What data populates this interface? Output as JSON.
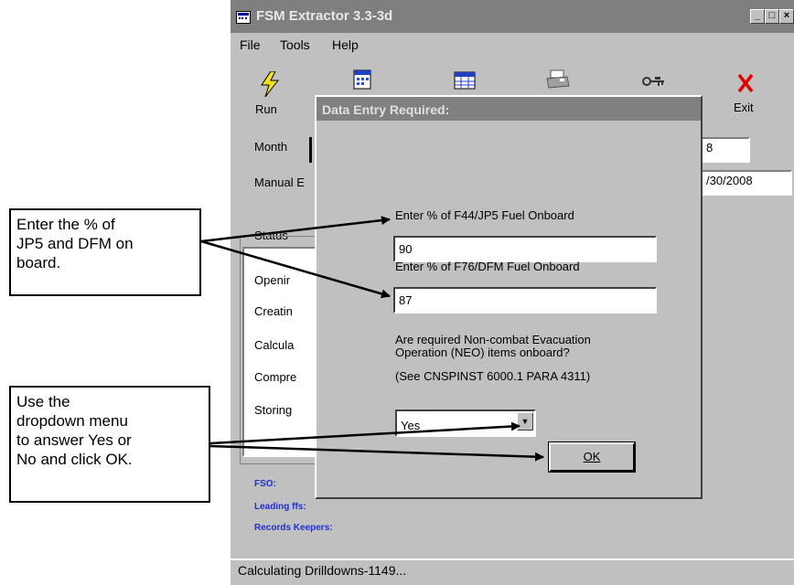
{
  "window": {
    "title": "FSM Extractor 3.3-3d"
  },
  "menu": {
    "file": "File",
    "tools": "Tools",
    "help": "Help"
  },
  "toolbar": {
    "run": "Run",
    "exit": "Exit"
  },
  "form": {
    "month_label": "Month",
    "manual_label": "Manual E",
    "month_value_tail": "8",
    "date_value_tail": "/30/2008",
    "status_label": "Status",
    "status_items": [
      "Openir",
      "Creatin",
      "Calcula",
      "Compre",
      "Storing"
    ],
    "fso_label": "FSO:",
    "leading_label": "Leading ffs:",
    "records_label": "Records Keepers:"
  },
  "statusbar": {
    "text": "Calculating Drilldowns-1149..."
  },
  "dialog": {
    "title": "Data Entry Required:",
    "jp5_label": "Enter % of F44/JP5 Fuel Onboard",
    "jp5_value": "90",
    "dfm_label": "Enter % of F76/DFM Fuel Onboard",
    "dfm_value": "87",
    "neo_question_1": "Are required Non-combat Evacuation",
    "neo_question_2": "Operation (NEO) items onboard?",
    "neo_reference": "(See CNSPINST 6000.1 PARA 4311)",
    "neo_selected": "Yes",
    "ok_label": "OK"
  },
  "callouts": {
    "fuel": [
      "Enter the % of",
      "JP5 and DFM on",
      "board."
    ],
    "dropdown": [
      "Use the",
      "dropdown menu",
      "to answer Yes or",
      "No and click OK."
    ]
  }
}
